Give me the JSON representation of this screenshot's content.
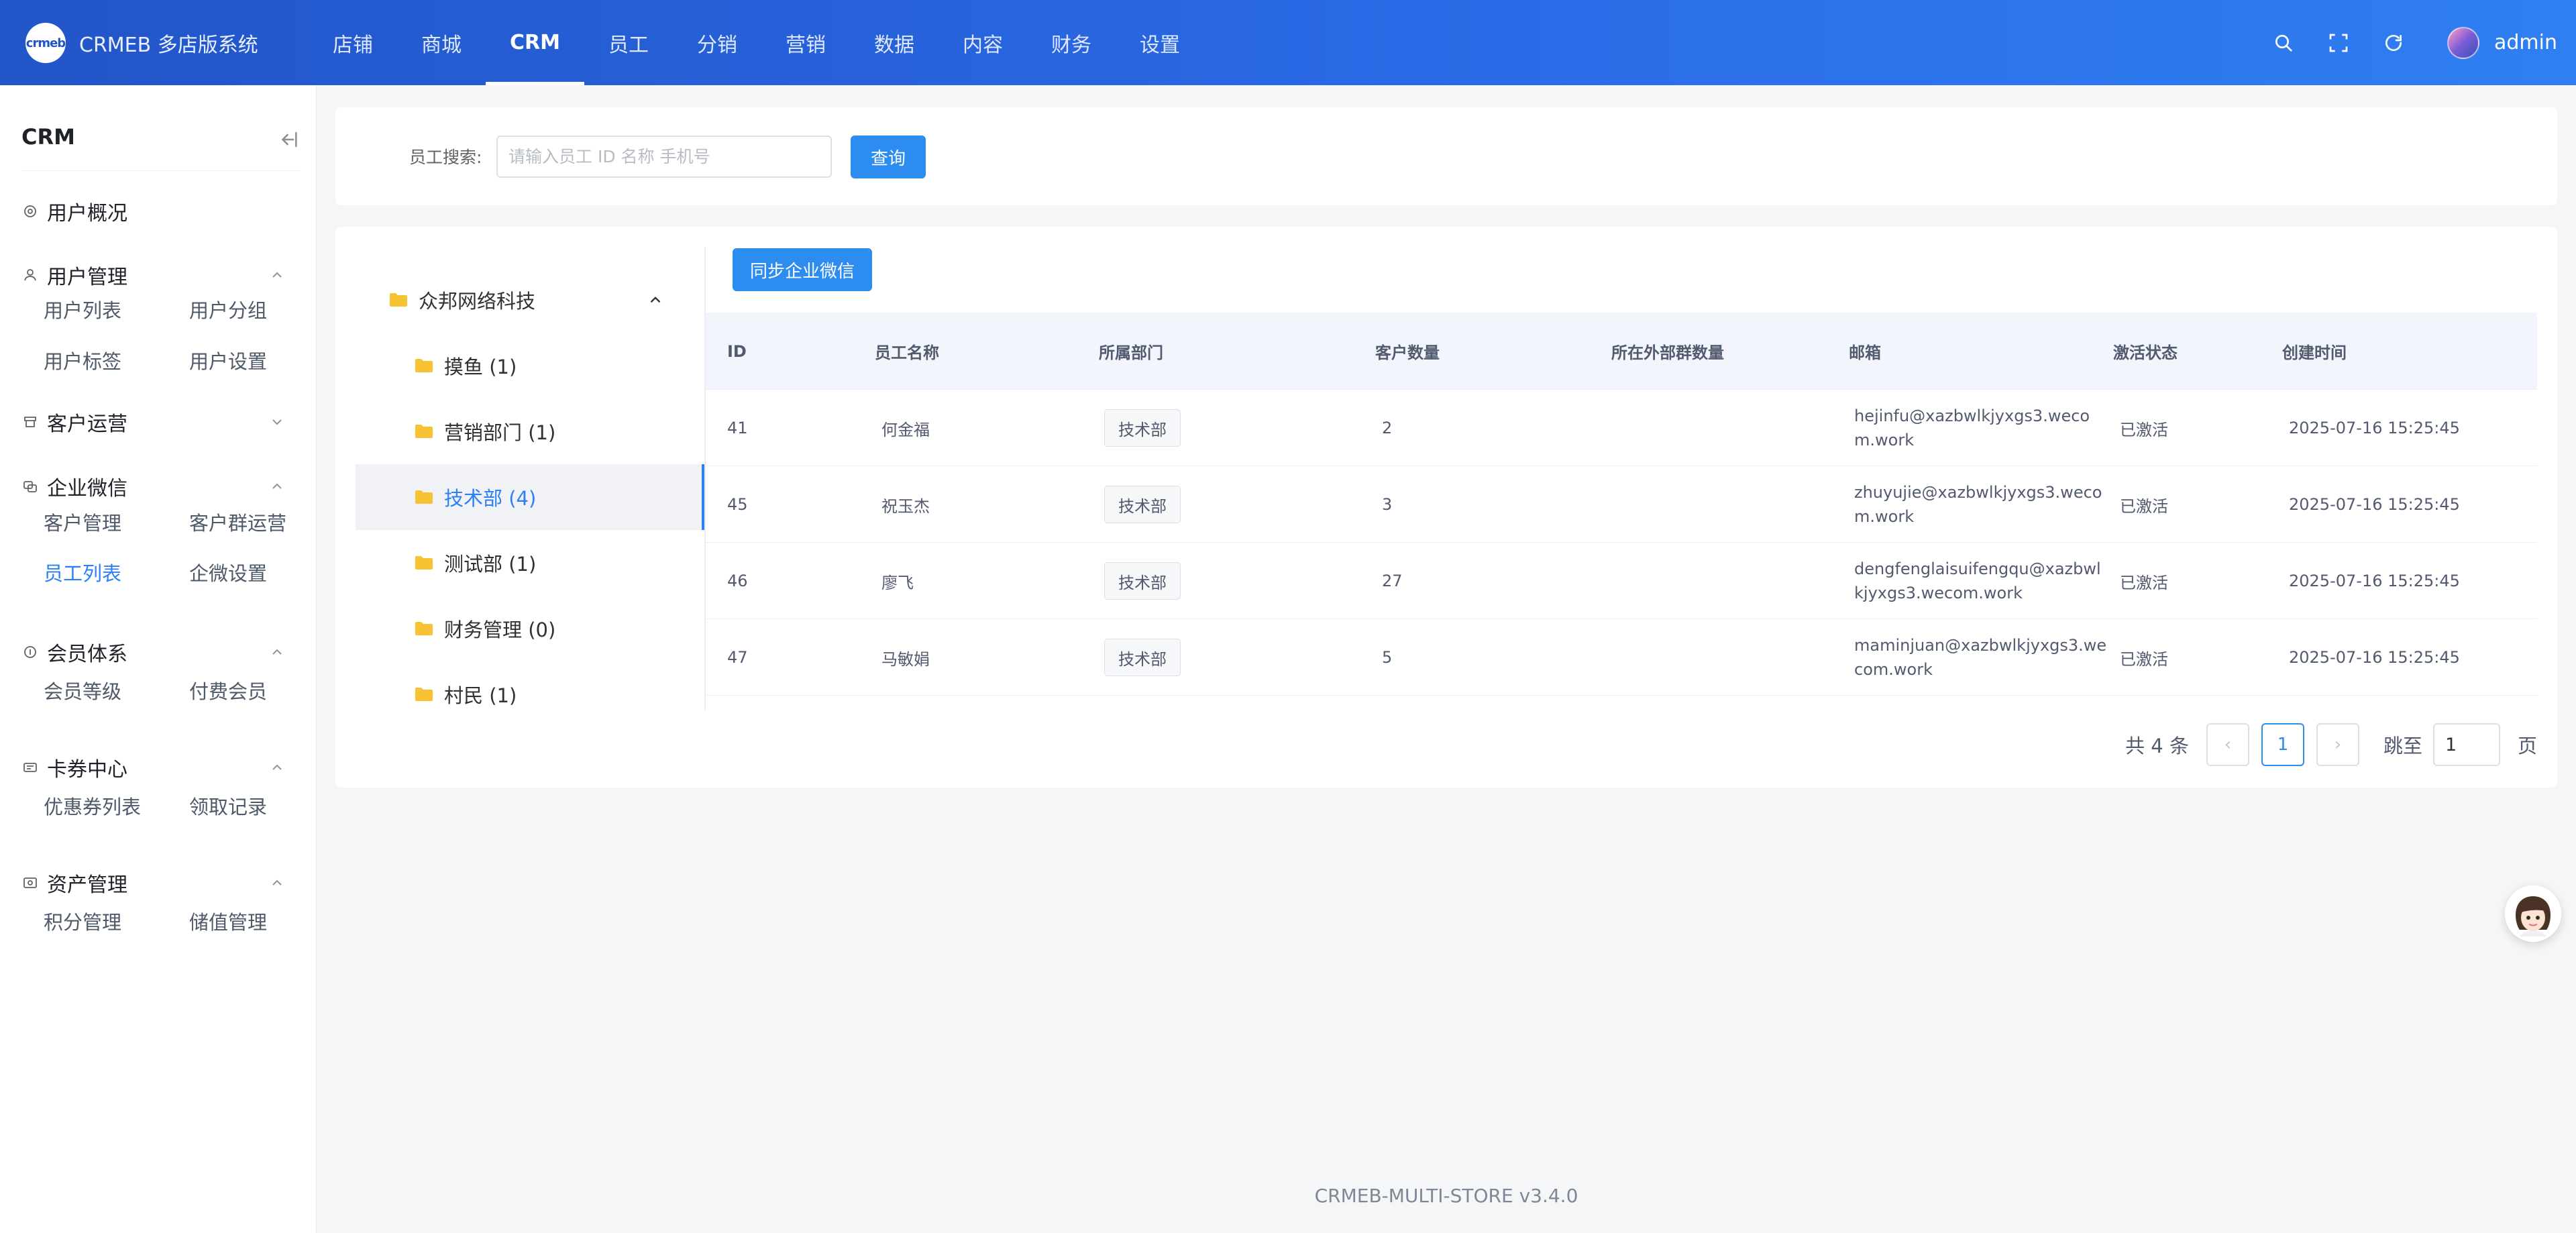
{
  "brand": {
    "logo_text": "crmeb",
    "title": "CRMEB 多店版系统"
  },
  "topnav": [
    {
      "label": "店铺",
      "active": false
    },
    {
      "label": "商城",
      "active": false
    },
    {
      "label": "CRM",
      "active": true
    },
    {
      "label": "员工",
      "active": false
    },
    {
      "label": "分销",
      "active": false
    },
    {
      "label": "营销",
      "active": false
    },
    {
      "label": "数据",
      "active": false
    },
    {
      "label": "内容",
      "active": false
    },
    {
      "label": "财务",
      "active": false
    },
    {
      "label": "设置",
      "active": false
    }
  ],
  "user": {
    "name": "admin"
  },
  "sidebar": {
    "title": "CRM",
    "groups": [
      {
        "label": "用户概况",
        "icon": "dashboard-icon",
        "items": []
      },
      {
        "label": "用户管理",
        "icon": "user-icon",
        "expanded": true,
        "items": [
          "用户列表",
          "用户分组",
          "用户标签",
          "用户设置"
        ]
      },
      {
        "label": "客户运营",
        "icon": "customer-ops-icon",
        "expanded": false,
        "items": []
      },
      {
        "label": "企业微信",
        "icon": "wecom-icon",
        "expanded": true,
        "items": [
          "客户管理",
          "客户群运营",
          "员工列表",
          "企微设置"
        ]
      },
      {
        "label": "会员体系",
        "icon": "member-icon",
        "expanded": true,
        "items": [
          "会员等级",
          "付费会员"
        ]
      },
      {
        "label": "卡券中心",
        "icon": "coupon-icon",
        "expanded": true,
        "items": [
          "优惠券列表",
          "领取记录"
        ]
      },
      {
        "label": "资产管理",
        "icon": "asset-icon",
        "expanded": true,
        "items": [
          "积分管理",
          "储值管理"
        ]
      }
    ],
    "active_item": "员工列表"
  },
  "search": {
    "label": "员工搜索:",
    "placeholder": "请输入员工 ID 名称 手机号",
    "value": "",
    "button": "查询"
  },
  "tree": {
    "root": "众邦网络科技",
    "children": [
      "摸鱼 (1)",
      "营销部门 (1)",
      "技术部 (4)",
      "测试部 (1)",
      "财务管理 (0)",
      "村民 (1)"
    ],
    "active": "技术部 (4)"
  },
  "sync_button": "同步企业微信",
  "table": {
    "columns": [
      "ID",
      "员工名称",
      "所属部门",
      "客户数量",
      "所在外部群数量",
      "邮箱",
      "激活状态",
      "创建时间"
    ],
    "rows": [
      {
        "id": "41",
        "name": "何金福",
        "dept": "技术部",
        "customers": "2",
        "groups": "",
        "email": "hejinfu@xazbwlkjyxgs3.wecom.work",
        "status": "已激活",
        "created": "2025-07-16 15:25:45"
      },
      {
        "id": "45",
        "name": "祝玉杰",
        "dept": "技术部",
        "customers": "3",
        "groups": "",
        "email": "zhuyujie@xazbwlkjyxgs3.wecom.work",
        "status": "已激活",
        "created": "2025-07-16 15:25:45"
      },
      {
        "id": "46",
        "name": "廖飞",
        "dept": "技术部",
        "customers": "27",
        "groups": "",
        "email": "dengfenglaisuifengqu@xazbwlkjyxgs3.wecom.work",
        "status": "已激活",
        "created": "2025-07-16 15:25:45"
      },
      {
        "id": "47",
        "name": "马敏娟",
        "dept": "技术部",
        "customers": "5",
        "groups": "",
        "email": "maminjuan@xazbwlkjyxgs3.wecom.work",
        "status": "已激活",
        "created": "2025-07-16 15:25:45"
      }
    ]
  },
  "pagination": {
    "total": "共 4 条",
    "prev": "‹",
    "current": "1",
    "next": "›",
    "jump_label": "跳至",
    "jump_value": "1",
    "unit": "页"
  },
  "footer": "CRMEB-MULTI-STORE v3.4.0",
  "colors": {
    "primary": "#2d8cf0",
    "header_start": "#2255c8",
    "header_end": "#2f7ff2",
    "active_text": "#2d7ff5"
  }
}
